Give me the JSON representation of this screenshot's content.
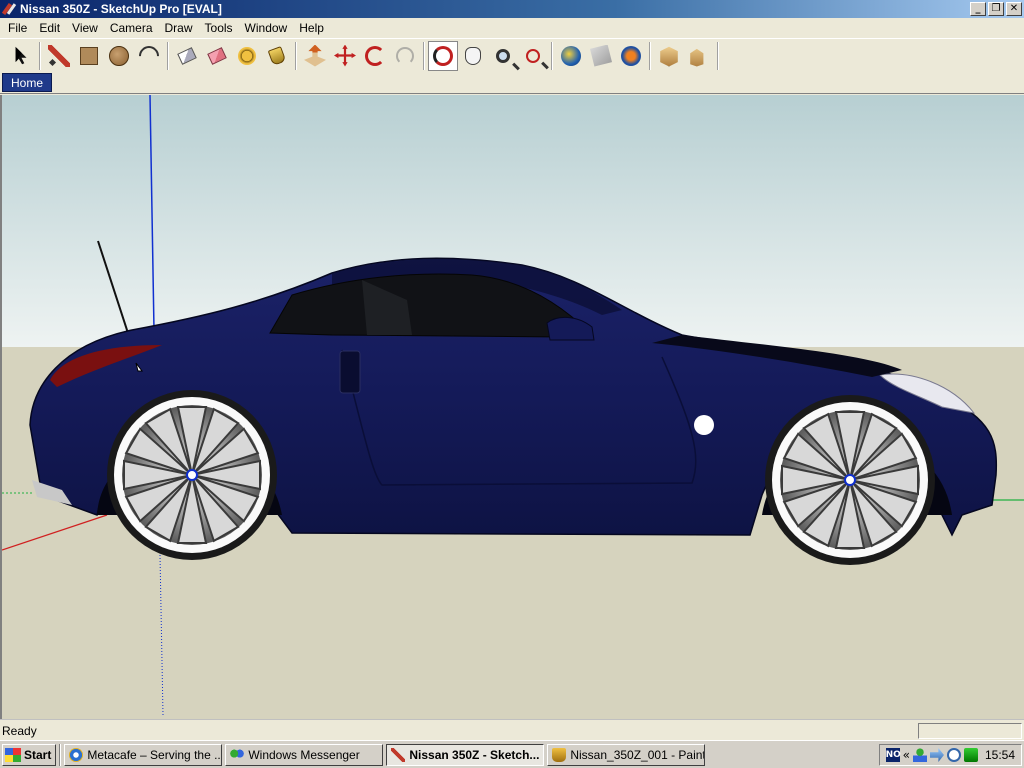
{
  "window": {
    "title": "Nissan 350Z - SketchUp Pro [EVAL]",
    "controls": [
      "minimize",
      "restore",
      "close"
    ]
  },
  "menu": [
    "File",
    "Edit",
    "View",
    "Camera",
    "Draw",
    "Tools",
    "Window",
    "Help"
  ],
  "toolbar": [
    {
      "name": "select-icon",
      "group": 0
    },
    {
      "name": "pencil-icon",
      "group": 1
    },
    {
      "name": "rectangle-icon",
      "group": 1
    },
    {
      "name": "circle-icon",
      "group": 1
    },
    {
      "name": "arc-icon",
      "group": 1
    },
    {
      "name": "make-component-icon",
      "group": 2
    },
    {
      "name": "eraser-icon",
      "group": 2
    },
    {
      "name": "tape-measure-icon",
      "group": 2
    },
    {
      "name": "paint-bucket-icon",
      "group": 2
    },
    {
      "name": "push-pull-icon",
      "group": 3
    },
    {
      "name": "move-icon",
      "group": 3
    },
    {
      "name": "rotate-icon",
      "group": 3
    },
    {
      "name": "offset-icon",
      "group": 3
    },
    {
      "name": "orbit-icon",
      "group": 4,
      "active": true
    },
    {
      "name": "pan-icon",
      "group": 4
    },
    {
      "name": "zoom-icon",
      "group": 4
    },
    {
      "name": "zoom-extents-icon",
      "group": 4
    },
    {
      "name": "get-current-view-icon",
      "group": 5
    },
    {
      "name": "toggle-terrain-icon",
      "group": 5
    },
    {
      "name": "place-model-icon",
      "group": 5
    },
    {
      "name": "get-models-icon",
      "group": 6
    },
    {
      "name": "share-model-icon",
      "group": 6
    }
  ],
  "scene_tabs": [
    {
      "label": "Home",
      "active": true
    }
  ],
  "viewport": {
    "sky_top": "#b7cfd2",
    "sky_bottom": "#eef3f2",
    "ground": "#d6d3be",
    "car_body": "#141a58",
    "axis_red": "#d02020",
    "axis_green": "#20b040",
    "axis_blue": "#1030d0"
  },
  "status": {
    "text": "Ready",
    "measurements": ""
  },
  "taskbar": {
    "start_label": "Start",
    "tasks": [
      {
        "label": "Metacafe – Serving the ...",
        "icon": "ie-icon",
        "active": false
      },
      {
        "label": "Windows Messenger",
        "icon": "messenger-icon",
        "active": false
      },
      {
        "label": "Nissan 350Z - Sketch...",
        "icon": "sketchup-icon",
        "active": true
      },
      {
        "label": "Nissan_350Z_001 - Paint",
        "icon": "paint-icon",
        "active": false
      }
    ],
    "tray": {
      "lang": "NO",
      "arrow": "«",
      "clock": "15:54"
    }
  }
}
